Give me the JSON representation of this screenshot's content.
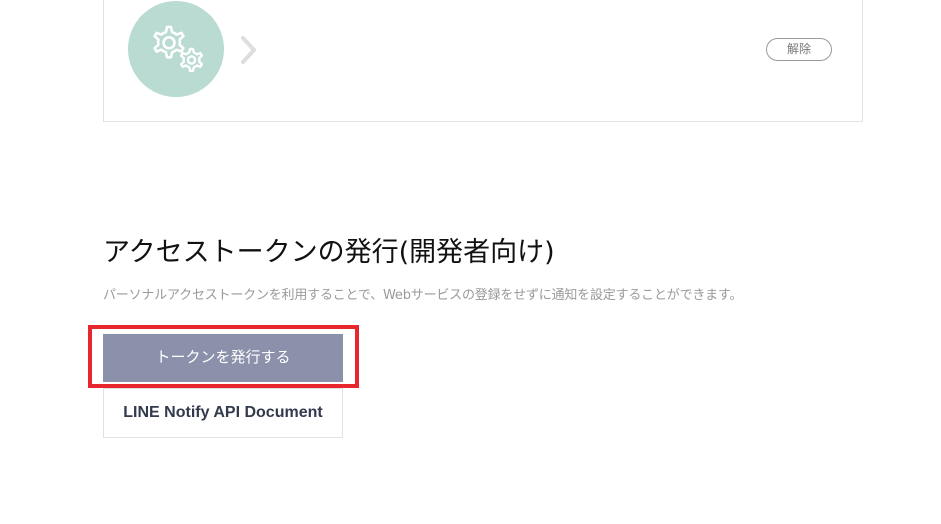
{
  "service_card": {
    "avatar_icon": "gears-icon",
    "avatar_color": "#b9dbd1",
    "chevron_icon": "chevron-right-icon",
    "unlink_label": "解除"
  },
  "token_section": {
    "title": "アクセストークンの発行(開発者向け)",
    "description": "パーソナルアクセストークンを利用することで、Webサービスの登録をせずに通知を設定することができます。",
    "issue_button_label": "トークンを発行する",
    "issue_button_color": "#8c91ab",
    "highlight_color": "#e8262d",
    "doc_button_label": "LINE Notify API Document"
  }
}
